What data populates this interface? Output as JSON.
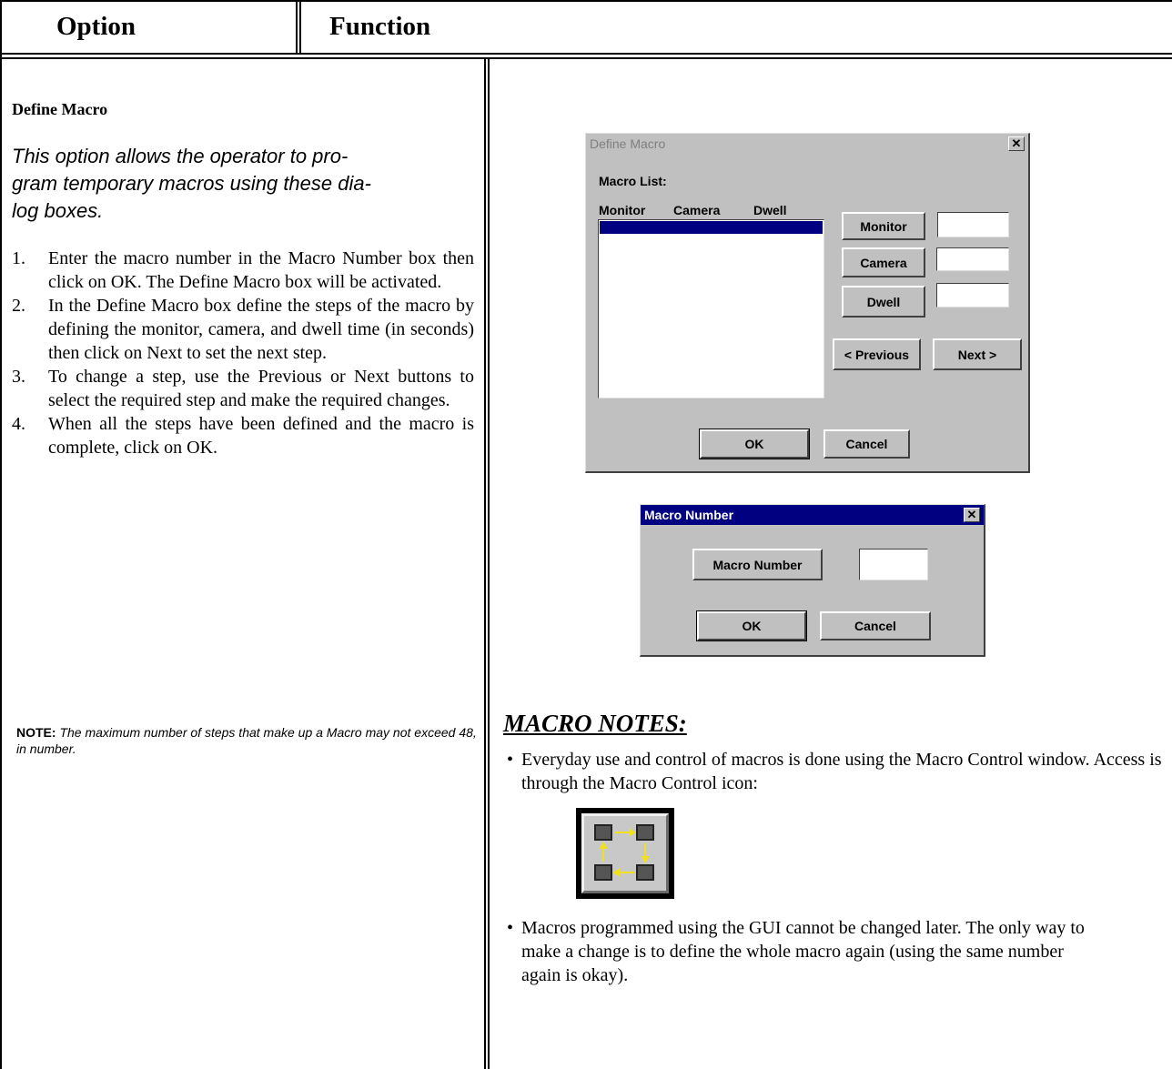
{
  "header": {
    "option": "Option",
    "function": "Function"
  },
  "left": {
    "title": "Define Macro",
    "intro": "This option allows the operator to program temporary macros using these dialog boxes.",
    "intro_lines": [
      "This option allows the operator to pro-",
      "gram temporary macros using these dia-",
      "log boxes."
    ],
    "steps": [
      {
        "num": "1.",
        "text": "Enter the macro number in the Macro Number box then click on OK. The Define Macro box will be activated."
      },
      {
        "num": "2.",
        "text": "In the Define Macro box define the steps of the macro by defining the monitor, camera, and dwell time (in seconds) then click on Next to set the next step."
      },
      {
        "num": "3.",
        "text": "To change a step, use the Previous or Next buttons to select the required step and make the required changes."
      },
      {
        "num": "4.",
        "text": "When all the steps have been defined and the macro is complete, click on OK."
      }
    ],
    "note_label": "NOTE:",
    "note_text": "The maximum number of steps that make up a Macro may not exceed 48, in number."
  },
  "define_dialog": {
    "title": "Define Macro",
    "macro_list_label": "Macro List:",
    "col_monitor": "Monitor",
    "col_camera": "Camera",
    "col_dwell": "Dwell",
    "btn_monitor": "Monitor",
    "btn_camera": "Camera",
    "btn_dwell": "Dwell",
    "btn_previous": "< Previous",
    "btn_next": "Next >",
    "btn_ok": "OK",
    "btn_cancel": "Cancel",
    "close": "✕"
  },
  "number_dialog": {
    "title": "Macro Number",
    "btn_macro_number": "Macro Number",
    "btn_ok": "OK",
    "btn_cancel": "Cancel",
    "close": "✕"
  },
  "notes": {
    "title": "MACRO NOTES:",
    "bullet1": "Everyday use and control of macros is done using the Macro Control window. Access is through the Macro Control icon:",
    "bullet2": "Macros programmed using the GUI cannot be changed later. The only way to make a change is to define the whole macro again (using the same number again is okay).",
    "icon": "macro-control-icon",
    "icon_arrow_color": "#f0e020"
  }
}
